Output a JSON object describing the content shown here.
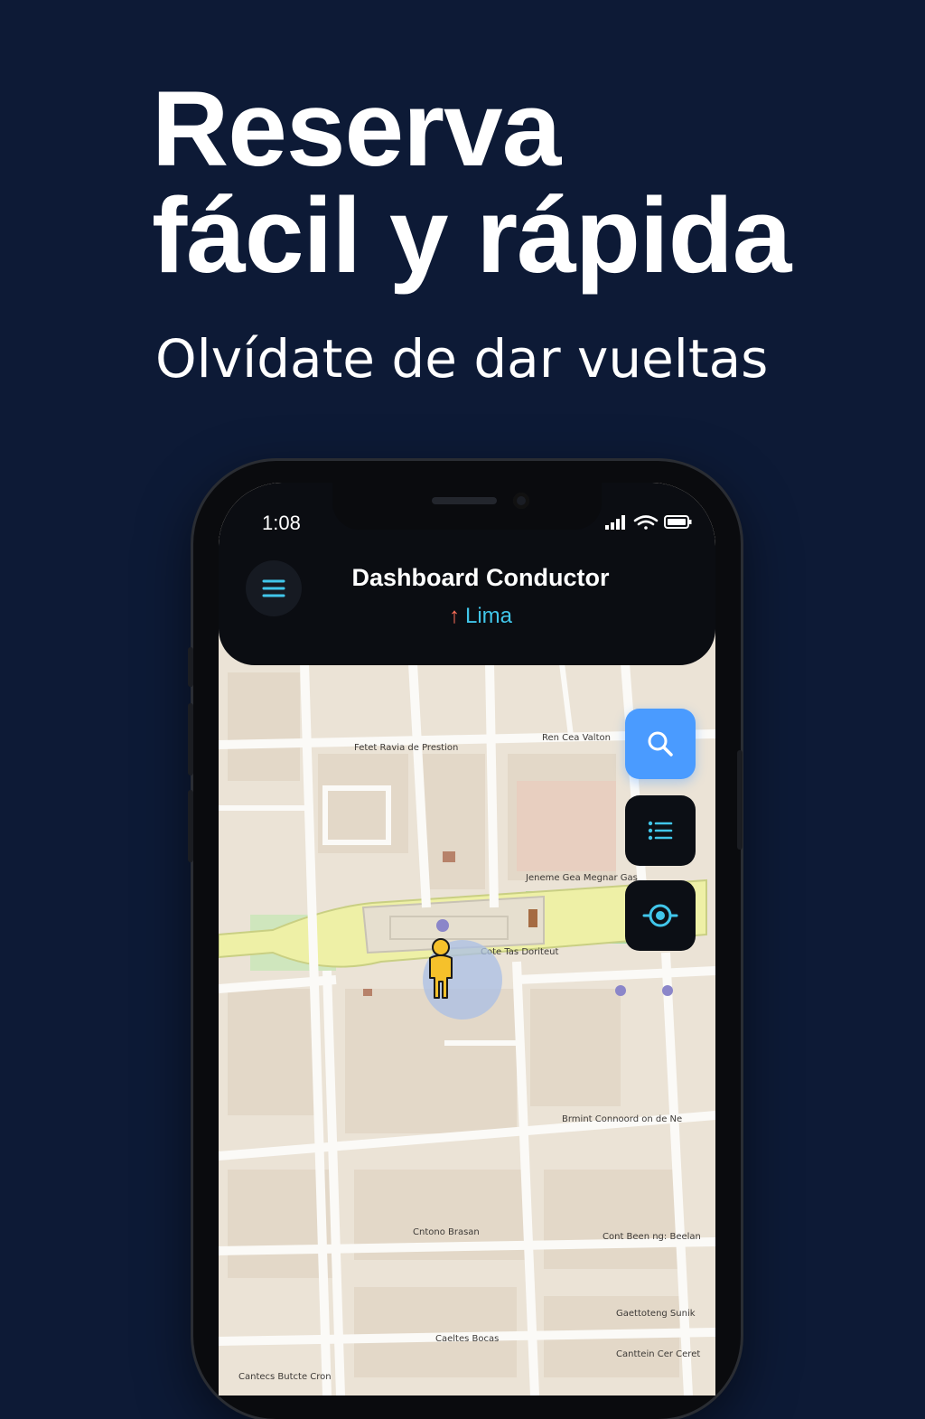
{
  "promo": {
    "headline": "Reserva fácil y rápida",
    "subline": "Olvídate de dar vueltas"
  },
  "status_bar": {
    "time": "1:08",
    "icons": [
      "signal-icon",
      "wifi-icon",
      "battery-icon"
    ]
  },
  "header": {
    "menu_icon": "hamburger-menu-icon",
    "title": "Dashboard Conductor",
    "location_icon": "arrow-up-icon",
    "location": "Lima"
  },
  "map_actions": [
    {
      "name": "search",
      "icon": "search-icon"
    },
    {
      "name": "list",
      "icon": "list-icon"
    },
    {
      "name": "locate",
      "icon": "target-icon"
    }
  ],
  "map": {
    "street_labels": [
      "Fetet Ravia de Prestion",
      "Ren Cea Valton",
      "Jeneme Gea Megnar Gas",
      "Cote Tas Doriteut",
      "Brmint Connoord on de Ne",
      "Cntono Brasan",
      "Cont Been ng: Beelan",
      "Gaettoteng Sunik",
      "Caeltes Bocas",
      "Canttein Cer Ceret",
      "Cantecs Butcte Cron"
    ]
  },
  "colors": {
    "background": "#0d1a36",
    "accent_cyan": "#41c6ea",
    "accent_blue": "#4a9bff",
    "arrow_red": "#ff6f5a"
  }
}
